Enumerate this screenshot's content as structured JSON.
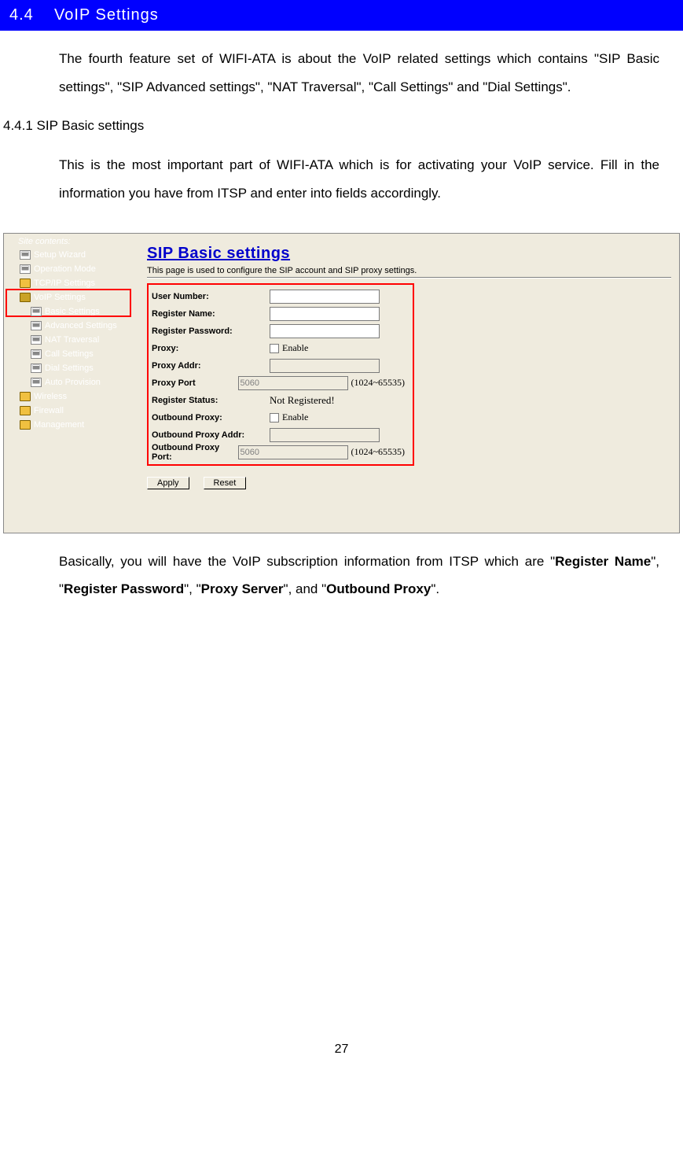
{
  "section": {
    "number": "4.4",
    "title": "VoIP Settings"
  },
  "para1": "The fourth feature set of WIFI-ATA is about the VoIP related settings which contains \"SIP Basic settings\", \"SIP Advanced settings\", \"NAT Traversal\", \"Call Settings\" and \"Dial Settings\".",
  "subheading": "4.4.1 SIP Basic settings",
  "para2": "This is the most important part of WIFI-ATA which is for activating your VoIP service. Fill in the information you have from ITSP and enter into fields accordingly.",
  "tree": {
    "title": "Site contents:",
    "items": [
      {
        "label": "Setup Wizard",
        "type": "page",
        "indent": 1
      },
      {
        "label": "Operation Mode",
        "type": "page",
        "indent": 1
      },
      {
        "label": "TCP/IP Settings",
        "type": "folder",
        "indent": 1
      },
      {
        "label": "VoIP Settings",
        "type": "folder-open",
        "indent": 1
      },
      {
        "label": "Basic Settings",
        "type": "page",
        "indent": 2
      },
      {
        "label": "Advanced Settings",
        "type": "page",
        "indent": 2
      },
      {
        "label": "NAT Traversal",
        "type": "page",
        "indent": 2
      },
      {
        "label": "Call Settings",
        "type": "page",
        "indent": 2
      },
      {
        "label": "Dial Settings",
        "type": "page",
        "indent": 2
      },
      {
        "label": "Auto Provision",
        "type": "page",
        "indent": 2
      },
      {
        "label": "Wireless",
        "type": "folder",
        "indent": 1
      },
      {
        "label": "Firewall",
        "type": "folder",
        "indent": 1
      },
      {
        "label": "Management",
        "type": "folder",
        "indent": 1
      }
    ]
  },
  "sip_panel": {
    "title": "SIP Basic settings",
    "desc": "This page is used to configure the SIP account and SIP proxy settings.",
    "rows": [
      {
        "label": "User Number:",
        "type": "text",
        "value": ""
      },
      {
        "label": "Register Name:",
        "type": "text",
        "value": ""
      },
      {
        "label": "Register Password:",
        "type": "text",
        "value": ""
      },
      {
        "label": "Proxy:",
        "type": "checkbox",
        "cb_label": "Enable"
      },
      {
        "label": "Proxy Addr:",
        "type": "text",
        "value": "",
        "disabled": true
      },
      {
        "label": "Proxy Port",
        "type": "text",
        "value": "5060",
        "disabled": true,
        "range": "(1024~65535)"
      },
      {
        "label": "Register Status:",
        "type": "status",
        "value": "Not Registered!"
      },
      {
        "label": "Outbound Proxy:",
        "type": "checkbox",
        "cb_label": "Enable"
      },
      {
        "label": "Outbound Proxy Addr:",
        "type": "text",
        "value": "",
        "disabled": true
      },
      {
        "label": "Outbound Proxy Port:",
        "type": "text",
        "value": "5060",
        "disabled": true,
        "range": "(1024~65535)"
      }
    ],
    "apply": "Apply",
    "reset": "Reset"
  },
  "para3_pre": "Basically, you will have the VoIP subscription information from ITSP which are \"",
  "bold1": "Register Name",
  "mid1": "\", \"",
  "bold2": "Register Password",
  "mid2": "\", \"",
  "bold3": "Proxy Server",
  "mid3": "\", and \"",
  "bold4": "Outbound Proxy",
  "para3_post": "\".",
  "page_number": "27"
}
